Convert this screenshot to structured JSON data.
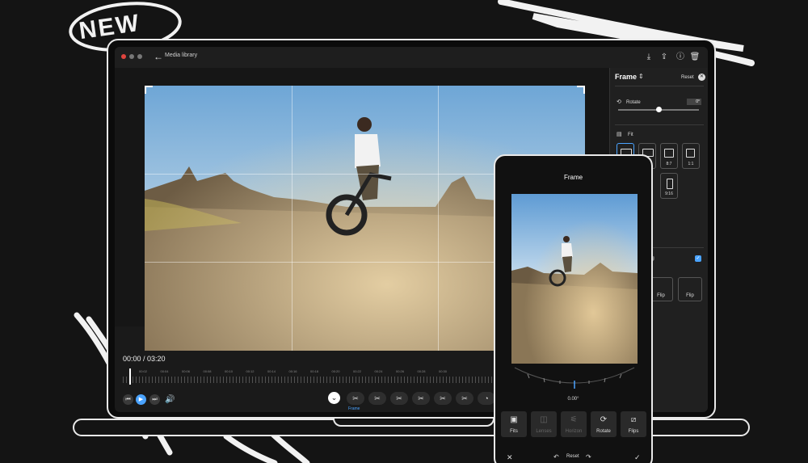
{
  "badge": {
    "text": "NEW"
  },
  "laptop": {
    "topbar": {
      "back_label": "Media library",
      "icons": [
        "download-icon",
        "share-icon",
        "info-icon",
        "trash-icon"
      ]
    },
    "timecode": "00:00 / 03:20",
    "ruler_labels": [
      "00:02",
      "00:04",
      "00:06",
      "00:08",
      "00:10",
      "00:12",
      "00:14",
      "00:16",
      "00:18",
      "00:20",
      "00:22",
      "00:24",
      "00:26",
      "00:28",
      "00:30"
    ],
    "active_tool_label": "Frame",
    "panel": {
      "title": "Frame",
      "reset": "Reset",
      "rotate_label": "Rotate",
      "rotate_value": "0°",
      "fit_label": "Fit",
      "ratios": [
        "",
        "",
        "8:7",
        "1:1",
        "",
        "",
        "9:16"
      ],
      "leveling_label": "eling",
      "flip_labels": [
        "Flip",
        "Flip"
      ]
    }
  },
  "phone": {
    "title": "Frame",
    "dial_value": "0.00°",
    "tools": [
      {
        "label": "Fits",
        "icon": "fits-icon",
        "dim": false
      },
      {
        "label": "Lenses",
        "icon": "lens-icon",
        "dim": true
      },
      {
        "label": "Horizon",
        "icon": "horizon-icon",
        "dim": true
      },
      {
        "label": "Rotate",
        "icon": "rotate-icon",
        "dim": false
      },
      {
        "label": "Flips",
        "icon": "flip-icon",
        "dim": false
      }
    ],
    "bottom": {
      "cancel": "✕",
      "undo": "↶",
      "reset": "Reset",
      "redo": "↷",
      "confirm": "✓"
    }
  },
  "colors": {
    "accent": "#4aa3ff",
    "outline": "#e9e9e9",
    "background": "#141414"
  }
}
